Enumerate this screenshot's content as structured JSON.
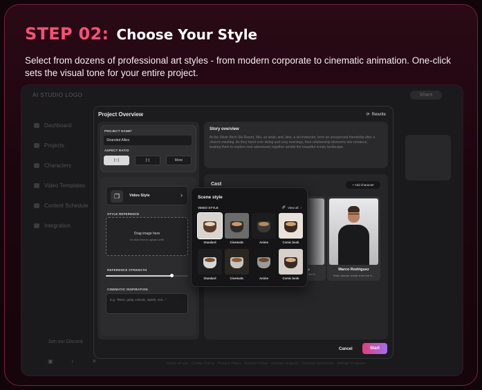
{
  "header": {
    "step": "STEP 02:",
    "title": "Choose Your Style",
    "description": "Select from dozens of professional art styles - from modern corporate to cinematic animation. One-click sets the visual tone for your entire project."
  },
  "background_app": {
    "logo": "AI STUDIO LOGO",
    "share": "Share",
    "sidebar": [
      "Dashboard",
      "Projects",
      "Characters",
      "Video Templates",
      "Content Schedule",
      "Integration"
    ],
    "discord": "Join our Discord",
    "footer": "Terms of use · Cookie Policy · Privacy Policy · Refund Policy · Contact Support · Content Guidelines · Affiliate Program"
  },
  "modal": {
    "title": "Project Overview",
    "rewrite": "Rewrite",
    "project_name_label": "PROJECT NAME*",
    "project_name": "Stranded Allies",
    "aspect_ratio_label": "ASPECT RATIO",
    "ratio_more": "More",
    "video_style": "Video Style",
    "style_reference_label": "STYLE REFERENCE",
    "drag_text": "Drag image here",
    "drag_sub": "Or click here to upload a file",
    "reference_strength_label": "REFERENCE STRENGTH",
    "reference_strength": 0.8,
    "cinematic_label": "CINEMATIC INSPIRATION",
    "cinematic_placeholder": "E.g. \"Retro, gritty, eclectic, stylish, noir...\"",
    "story_title": "Story overview",
    "story_body": "At the Silver Birch Ski Resort, Mia, an artist, and Jake, a ski instructor, form an unexpected friendship after a chance meeting. As they bond over skiing and cozy evenings, their relationship blossoms into romance, leading them to explore new adventures together amidst the beautiful snowy landscape.",
    "cast_title": "Cast",
    "add_character": "+ Add character",
    "cast": [
      {
        "name": "oz",
        "subtitle": "n the R..."
      },
      {
        "name": "Marco Rodriguez",
        "subtitle": "Stoic veteran soldier from the S..."
      }
    ],
    "cancel": "Cancel",
    "start": "Start"
  },
  "scene_style": {
    "title": "Scene style",
    "label": "VIDEO STYLE",
    "view_all": "View all",
    "styles": [
      {
        "label": "Standard",
        "bg": "#d9d4cf",
        "cup": "#5c3b2a",
        "foam": "#e8d3b8",
        "selected": true
      },
      {
        "label": "Cinematic",
        "bg": "#6b6b6b",
        "cup": "#2e2a26",
        "foam": "#c79a6b",
        "selected": false
      },
      {
        "label": "Anime",
        "bg": "#1c1c1c",
        "cup": "#3a3a3a",
        "foam": "#b88a5a",
        "selected": false
      },
      {
        "label": "Comic book",
        "bg": "#e8e2da",
        "cup": "#3a2a20",
        "foam": "#d0a070",
        "selected": false
      },
      {
        "label": "Standard",
        "bg": "#1e1e1e",
        "cup": "#d8d8d8",
        "foam": "#7a5230",
        "selected": false
      },
      {
        "label": "Cinematic",
        "bg": "#2a2622",
        "cup": "#c8c4c0",
        "foam": "#8a5a34",
        "selected": false
      },
      {
        "label": "Anime",
        "bg": "#161616",
        "cup": "#9a9a9a",
        "foam": "#6a4a2a",
        "selected": false
      },
      {
        "label": "Comic book",
        "bg": "#d6d0c8",
        "cup": "#3a2a22",
        "foam": "#d8b088",
        "selected": false
      }
    ]
  },
  "colors": {
    "accent": "#ff4f74",
    "start_gradient_from": "#e23e7c",
    "start_gradient_to": "#a46cf0"
  }
}
